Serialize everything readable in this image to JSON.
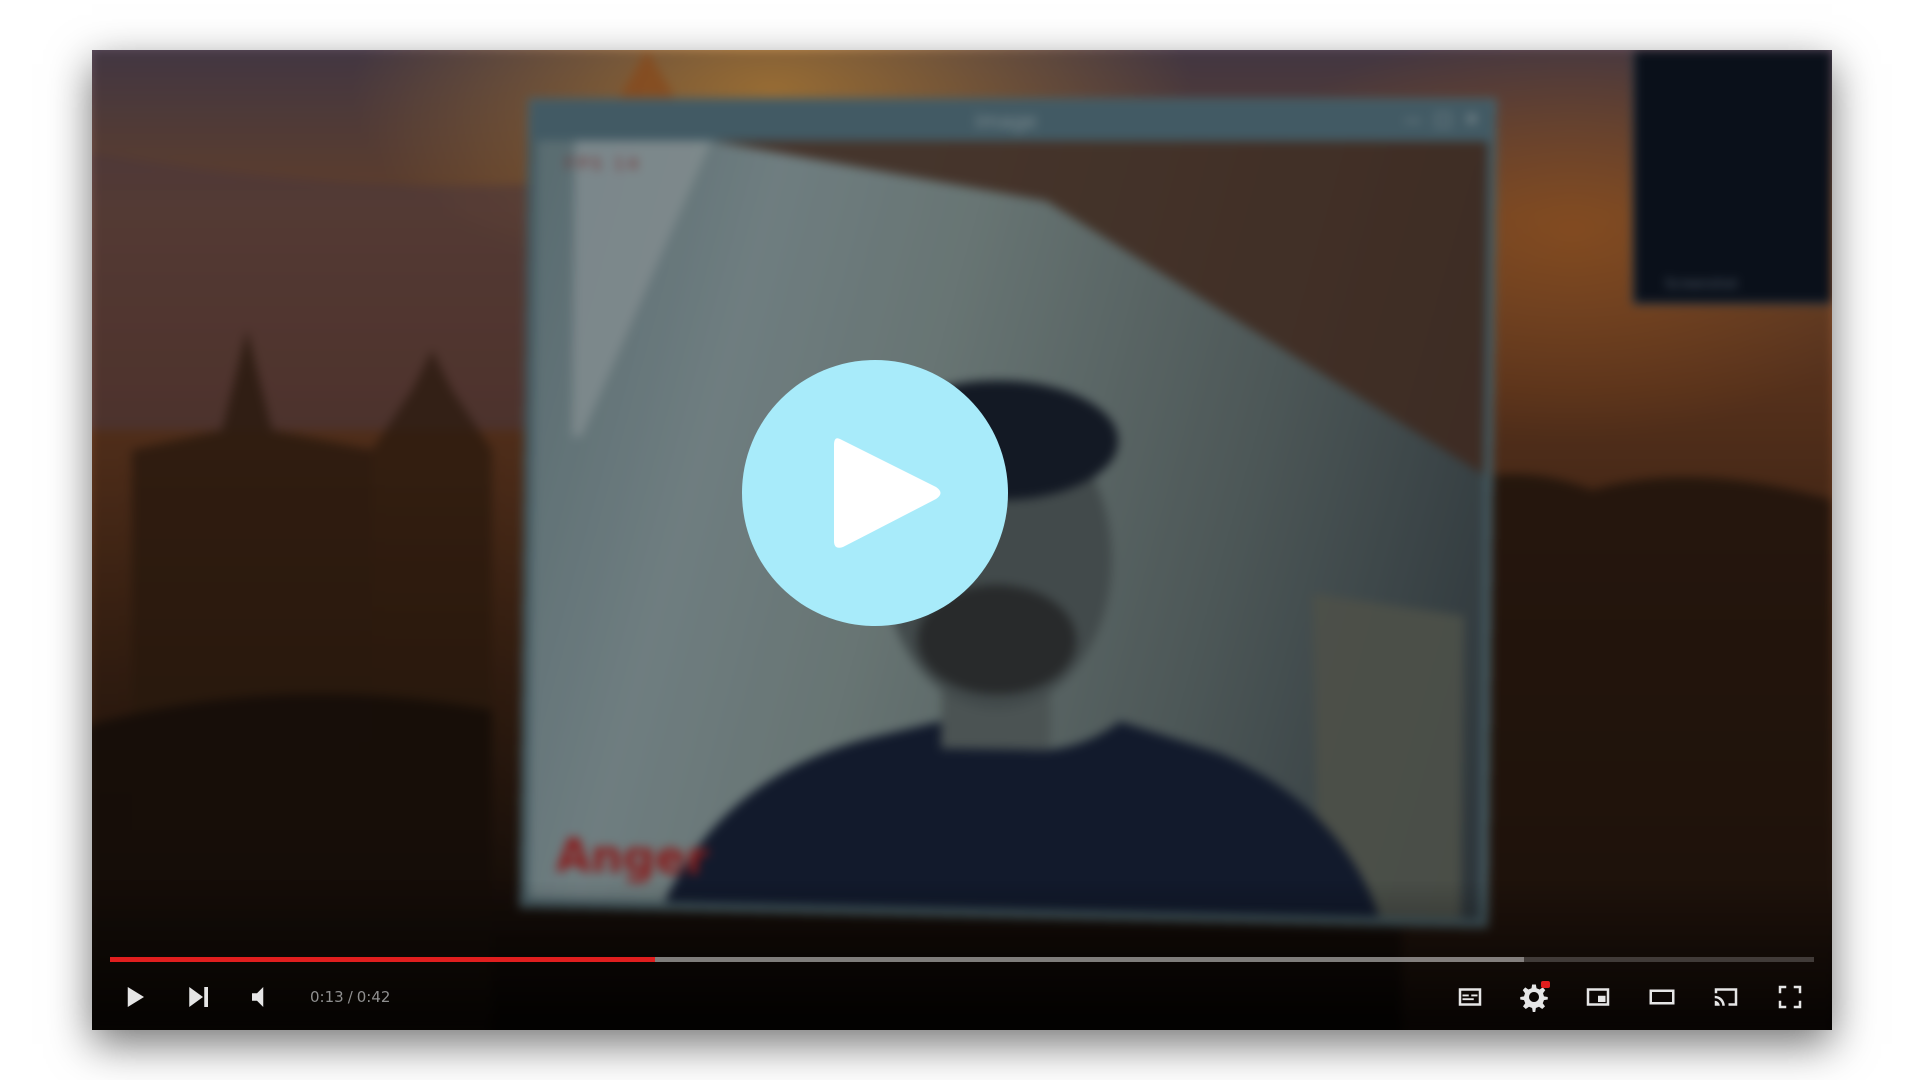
{
  "player": {
    "inner_window_title": "image",
    "inner_hud_text": "FPS 14",
    "emotion_label": "Anger",
    "corner_panel_label": "Screenshot",
    "time_current": "0:13",
    "time_separator": "/",
    "time_duration": "0:42",
    "progress_played_fraction": 0.32,
    "progress_buffered_fraction": 0.83,
    "accent_color": "#e01e1e",
    "big_play_color": "#a8ebfa"
  },
  "controls": {
    "left": [
      "play-icon",
      "next-icon",
      "volume-icon"
    ],
    "right": [
      "subtitles-icon",
      "settings-icon",
      "miniplayer-icon",
      "theater-icon",
      "cast-icon",
      "fullscreen-icon"
    ]
  }
}
